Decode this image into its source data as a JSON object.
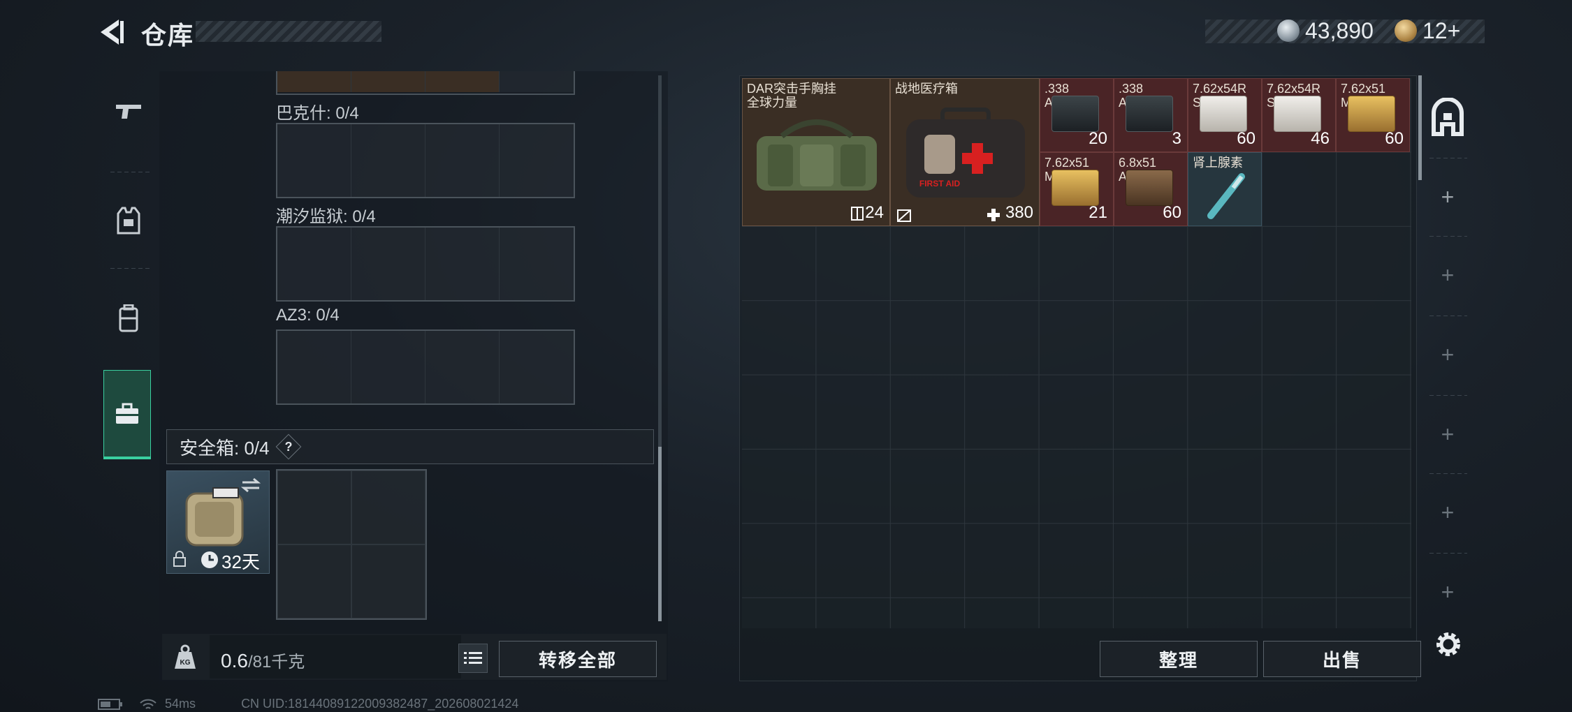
{
  "header": {
    "title": "仓库",
    "currency1": "43,890",
    "currency2": "12+"
  },
  "tabs": [
    {
      "icon": "gun-icon"
    },
    {
      "icon": "armor-vest-icon"
    },
    {
      "icon": "backpack-icon"
    },
    {
      "icon": "toolbox-icon",
      "active": true
    }
  ],
  "left_panel": {
    "slots": [
      {
        "label": "巴克什: 0/4"
      },
      {
        "label": "潮汐监狱: 0/4"
      },
      {
        "label": "AZ3: 0/4"
      }
    ],
    "safe_box": {
      "label": "安全箱: 0/4",
      "help": "?",
      "duration": "32天"
    },
    "weight_value": "0.6",
    "weight_cap": "/81千克",
    "transfer_all": "转移全部"
  },
  "stash_items": [
    {
      "name": "DAR突击手胸挂\n全球力量",
      "count": "24",
      "color": "brown",
      "icon": "chest-rig-bag-icon"
    },
    {
      "name": "战地医疗箱",
      "count": "380",
      "color": "brown",
      "icon": "first-aid-kit-icon"
    },
    {
      "name": ".338\nAP",
      "count": "20",
      "color": "red",
      "icon": "ammo-box-dark-icon"
    },
    {
      "name": ".338\nAP",
      "count": "3",
      "color": "red",
      "icon": "ammo-box-dark-icon"
    },
    {
      "name": "7.62x54R\nSNB",
      "count": "60",
      "color": "red",
      "icon": "ammo-box-white-icon"
    },
    {
      "name": "7.62x54R\nSNB",
      "count": "46",
      "color": "red",
      "icon": "ammo-box-white-icon"
    },
    {
      "name": "7.62x51\nM61",
      "count": "60",
      "color": "red",
      "icon": "ammo-box-gold-icon"
    },
    {
      "name": "7.62x51\nM61",
      "count": "21",
      "color": "red",
      "icon": "ammo-box-gold-icon"
    },
    {
      "name": "6.8x51\nAP",
      "count": "60",
      "color": "red",
      "icon": "ammo-crate-icon"
    },
    {
      "name": "肾上腺素",
      "count": "",
      "color": "blue",
      "icon": "syringe-icon"
    }
  ],
  "right_footer": {
    "sort": "整理",
    "sell": "出售"
  },
  "status_bar": {
    "ping": "54ms",
    "uid": "CN UID:1814408912200938248​7_202608021424"
  }
}
